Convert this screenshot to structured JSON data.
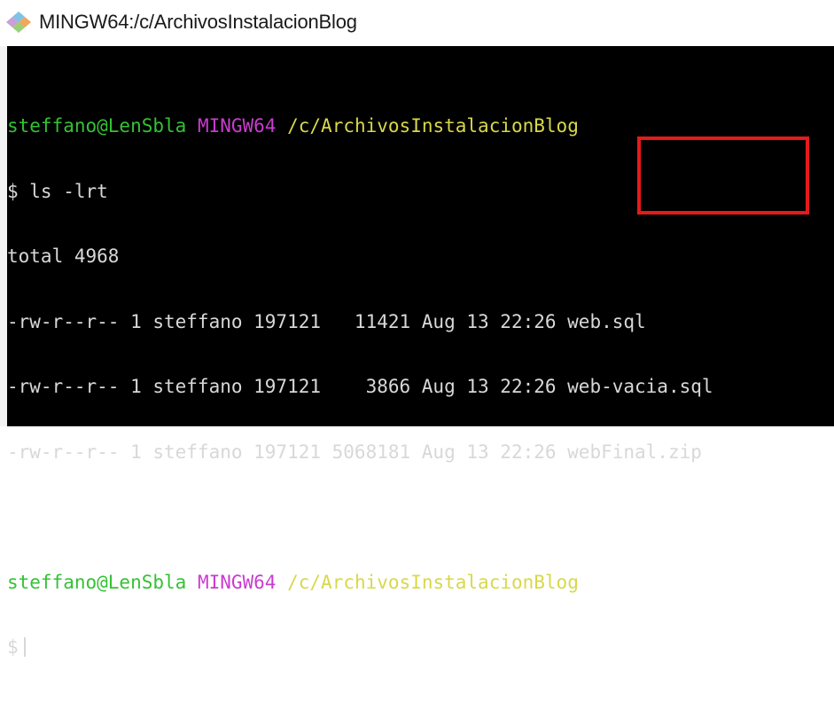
{
  "window": {
    "title": "MINGW64:/c/ArchivosInstalacionBlog",
    "icon": "git-bash-diamond-icon"
  },
  "terminal": {
    "prompt1": {
      "user": "steffano@LenSbla",
      "host": "MINGW64",
      "path": "/c/ArchivosInstalacionBlog"
    },
    "command_line": "$ ls -lrt",
    "total_line": "total 4968",
    "entries": [
      {
        "meta": "-rw-r--r-- 1 steffano 197121   11421 Aug 13 22:26 ",
        "name": "web.sql"
      },
      {
        "meta": "-rw-r--r-- 1 steffano 197121    3866 Aug 13 22:26 ",
        "name": "web-vacia.sql"
      },
      {
        "meta": "-rw-r--r-- 1 steffano 197121 5068181 Aug 13 22:26 ",
        "name": "webFinal.zip"
      }
    ],
    "prompt2": {
      "user": "steffano@LenSbla",
      "host": "MINGW64",
      "path": "/c/ArchivosInstalacionBlog"
    },
    "input_prompt": "$",
    "colors": {
      "background": "#000000",
      "user": "#34c234",
      "host": "#c93ccf",
      "path": "#d8d84a",
      "text": "#d8d8d8",
      "highlight": "#e51b1b"
    }
  }
}
